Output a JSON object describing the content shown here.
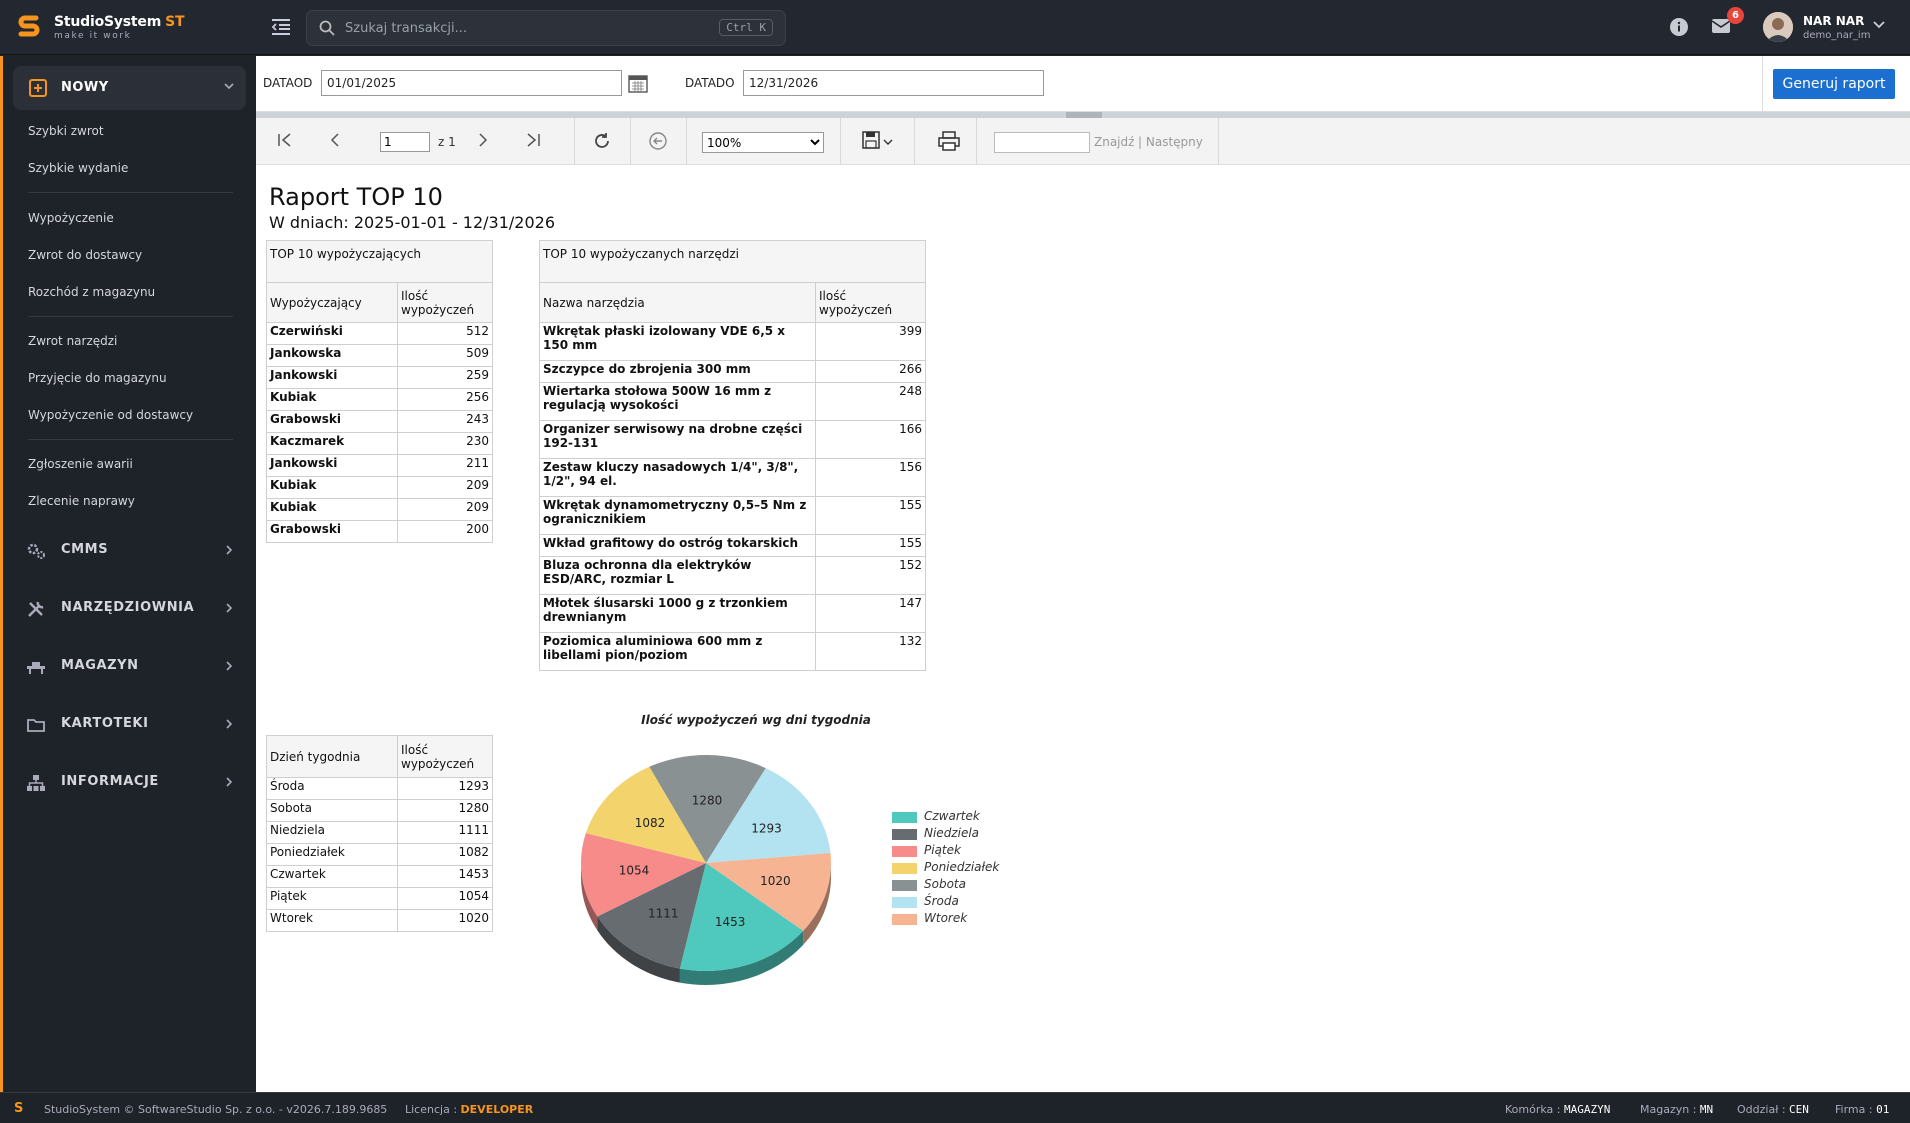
{
  "app": {
    "name": "StudioSystem",
    "suffix": "ST",
    "tagline": "make it work"
  },
  "search": {
    "placeholder": "Szukaj transakcji...",
    "shortcut": "Ctrl K"
  },
  "header": {
    "notifications_count": "6",
    "user_name": "NAR NAR",
    "user_login": "demo_nar_im"
  },
  "sidebar": {
    "section_new": "NOWY",
    "new_items": [
      "Szybki zwrot",
      "Szybkie wydanie",
      "Wypożyczenie",
      "Zwrot do dostawcy",
      "Rozchód z magazynu",
      "Zwrot narzędzi",
      "Przyjęcie do magazynu",
      "Wypożyczenie od dostawcy",
      "Zgłoszenie awarii",
      "Zlecenie naprawy"
    ],
    "sections": [
      "CMMS",
      "NARZĘDZIOWNIA",
      "MAGAZYN",
      "KARTOTEKI",
      "INFORMACJE"
    ]
  },
  "params": {
    "date_from_label": "DATAOD",
    "date_from": "01/01/2025",
    "date_to_label": "DATADO",
    "date_to": "12/31/2026",
    "generate_label": "Generuj raport"
  },
  "toolbar": {
    "page": "1",
    "of_label": "z 1",
    "zoom": "100%",
    "find_label": "Znajdź",
    "next_label": "| Następny"
  },
  "report": {
    "title": "Raport TOP 10",
    "subtitle": "W dniach: 2025-01-01 - 12/31/2026",
    "top_borrowers": {
      "title": "TOP 10 wypożyczających",
      "col_name": "Wypożyczający",
      "col_count": "Ilość wypożyczeń",
      "rows": [
        [
          "Czerwiński",
          "512"
        ],
        [
          "Jankowska",
          "509"
        ],
        [
          "Jankowski",
          "259"
        ],
        [
          "Kubiak",
          "256"
        ],
        [
          "Grabowski",
          "243"
        ],
        [
          "Kaczmarek",
          "230"
        ],
        [
          "Jankowski",
          "211"
        ],
        [
          "Kubiak",
          "209"
        ],
        [
          "Kubiak",
          "209"
        ],
        [
          "Grabowski",
          "200"
        ]
      ]
    },
    "top_tools": {
      "title": "TOP 10 wypożyczanych narzędzi",
      "col_name": "Nazwa narzędzia",
      "col_count": "Ilość wypożyczeń",
      "rows": [
        [
          "Wkrętak płaski izolowany VDE 6,5 x 150 mm",
          "399"
        ],
        [
          "Szczypce do zbrojenia 300 mm",
          "266"
        ],
        [
          "Wiertarka stołowa 500W 16 mm z regulacją wysokości",
          "248"
        ],
        [
          "Organizer serwisowy na drobne części 192-131",
          "166"
        ],
        [
          "Zestaw kluczy nasadowych 1/4\", 3/8\", 1/2\", 94 el.",
          "156"
        ],
        [
          "Wkrętak dynamometryczny 0,5–5 Nm z ogranicznikiem",
          "155"
        ],
        [
          "Wkład grafitowy do ostróg tokarskich",
          "155"
        ],
        [
          "Bluza ochronna dla elektryków ESD/ARC, rozmiar L",
          "152"
        ],
        [
          "Młotek ślusarski 1000 g z trzonkiem drewnianym",
          "147"
        ],
        [
          "Poziomica aluminiowa 600 mm z libellami pion/poziom",
          "132"
        ]
      ]
    },
    "weekday": {
      "col_day": "Dzień tygodnia",
      "col_count": "Ilość wypożyczeń",
      "rows": [
        [
          "Środa",
          "1293"
        ],
        [
          "Sobota",
          "1280"
        ],
        [
          "Niedziela",
          "1111"
        ],
        [
          "Poniedziałek",
          "1082"
        ],
        [
          "Czwartek",
          "1453"
        ],
        [
          "Piątek",
          "1054"
        ],
        [
          "Wtorek",
          "1020"
        ]
      ]
    }
  },
  "chart_data": {
    "type": "pie",
    "title": "Ilość wypożyczeń wg dni tygodnia",
    "categories": [
      "Czwartek",
      "Niedziela",
      "Piątek",
      "Poniedziałek",
      "Sobota",
      "Środa",
      "Wtorek"
    ],
    "values": [
      1453,
      1111,
      1054,
      1082,
      1280,
      1293,
      1020
    ],
    "colors": [
      "#4fc9bd",
      "#676c71",
      "#f68b8a",
      "#f3d36c",
      "#8a9192",
      "#b3e2f0",
      "#f7b493"
    ],
    "legend": "right",
    "style": "3d"
  },
  "footer": {
    "copyright": "StudioSystem © SoftwareStudio Sp. z o.o. - v2026.7.189.9685",
    "license_label": "Licencja :",
    "license_value": "DEVELOPER",
    "cell_label": "Komórka :",
    "cell_value": "MAGAZYN",
    "warehouse_label": "Magazyn :",
    "warehouse_value": "MN",
    "branch_label": "Oddział :",
    "branch_value": "CEN",
    "company_label": "Firma :",
    "company_value": "01"
  },
  "colors": {
    "accent": "#f7941d",
    "primary_button": "#1a6fd0",
    "badge": "#e8453c"
  }
}
